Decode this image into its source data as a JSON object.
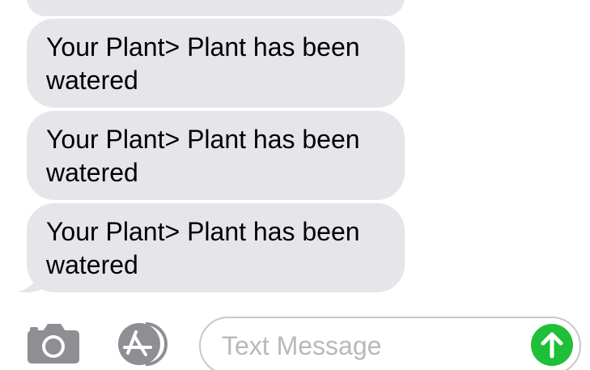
{
  "colors": {
    "bubble": "#e5e5ea",
    "send_button": "#1fbf3a",
    "icon_gray": "#8e8e93",
    "placeholder": "#b8b8bd"
  },
  "messages": [
    {
      "line1": "Your Plant> Plant has been",
      "line2": "watered"
    },
    {
      "line1": "Your Plant> Plant has been",
      "line2": "watered"
    },
    {
      "line1": "Your Plant> Plant has been",
      "line2": "watered"
    }
  ],
  "composer": {
    "placeholder": "Text Message",
    "camera_icon": "camera-icon",
    "apps_icon": "app-store-icon",
    "send_icon": "arrow-up-icon"
  }
}
